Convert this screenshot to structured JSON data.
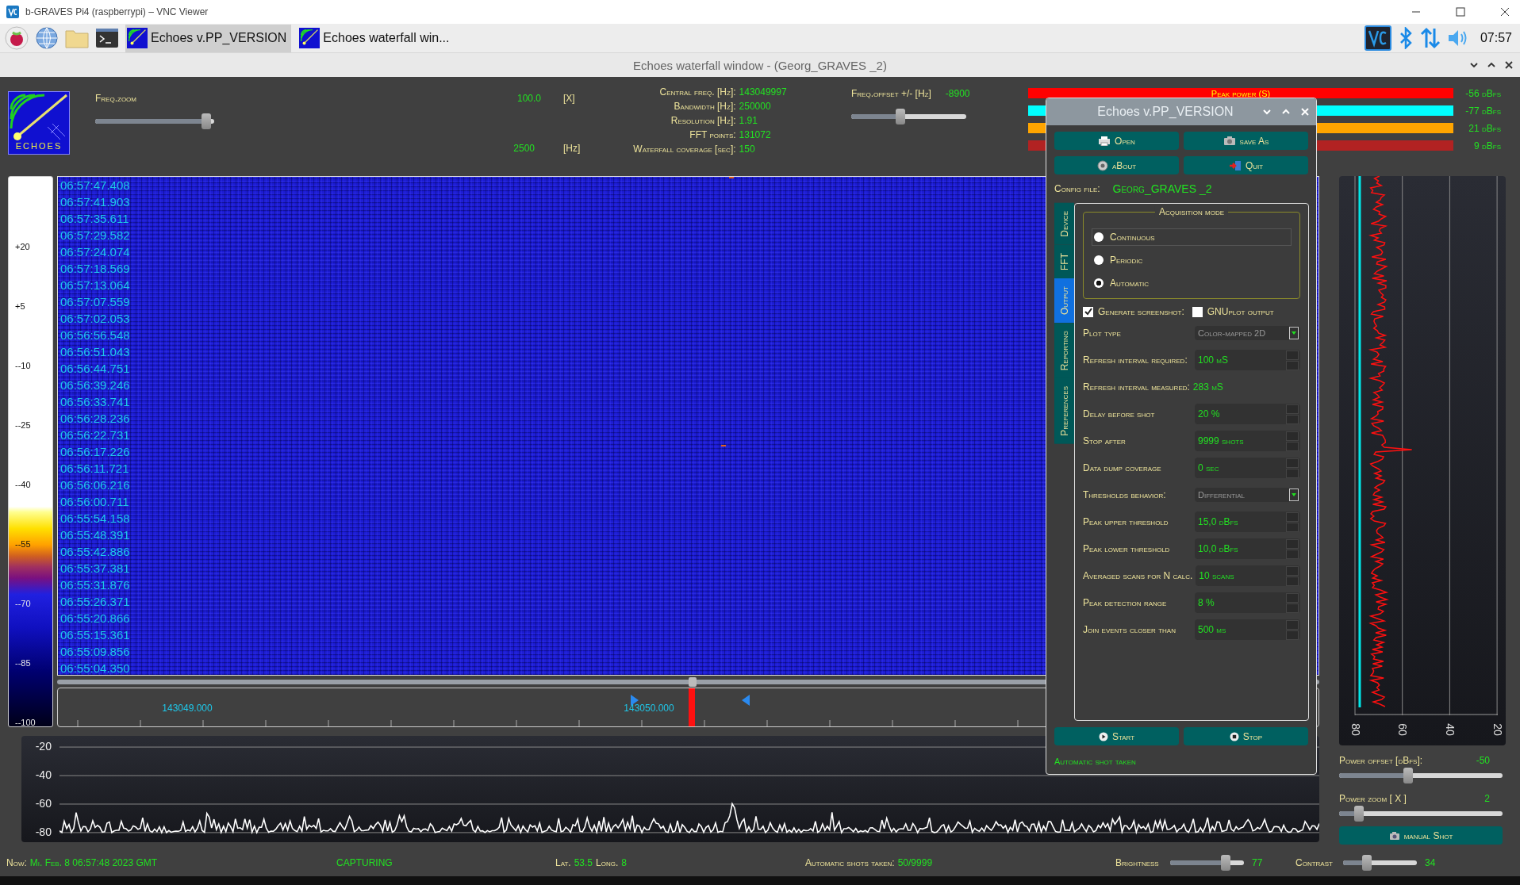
{
  "vnc_window": {
    "title": "b-GRAVES Pi4 (raspberrypi) – VNC Viewer"
  },
  "taskbar": {
    "tasks": [
      {
        "label": "Echoes v.PP_VERSION",
        "selected": true
      },
      {
        "label": "Echoes waterfall win...",
        "selected": false
      }
    ],
    "clock": "07:57"
  },
  "window": {
    "title": "Echoes waterfall window - (Georg_GRAVES _2)"
  },
  "header": {
    "logo_text": "ECHOES",
    "freq_zoom": {
      "label": "Freq.zoom",
      "level": 0.93,
      "value": "100.0",
      "unit": "[X]"
    },
    "span": {
      "value": "2500",
      "unit": "[Hz]"
    }
  },
  "info": [
    {
      "label": "Central freq. [Hz]:",
      "value": "143049997"
    },
    {
      "label": "Bandwidth  [Hz]:",
      "value": "250000"
    },
    {
      "label": "Resolution [Hz]:",
      "value": "1.91"
    },
    {
      "label": "FFT points:",
      "value": "131072"
    },
    {
      "label": "Waterfall coverage [sec]:",
      "value": "150"
    }
  ],
  "freq_offset": {
    "label": "Freq.offset +/- [Hz]",
    "value": "-8900",
    "level": 0.43
  },
  "power_bars": [
    {
      "label": "Peak power (S)",
      "color": "#ff0000",
      "reading": "-56 dBfs"
    },
    {
      "color": "#00ffff",
      "reading": "-77 dBfs"
    },
    {
      "color": "#ffa500",
      "reading": "21 dBfs"
    },
    {
      "color": "#b22222",
      "reading": "9 dBfs"
    }
  ],
  "color_scale": {
    "labels": [
      "+20",
      "+5",
      "--10",
      "--25",
      "--40",
      "--55",
      "--70",
      "--85",
      "--100"
    ]
  },
  "waterfall": {
    "timestamps": [
      "06:57:47.408",
      "06:57:41.903",
      "06:57:35.611",
      "06:57:29.582",
      "06:57:24.074",
      "06:57:18.569",
      "06:57:13.064",
      "06:57:07.559",
      "06:57:02.053",
      "06:56:56.548",
      "06:56:51.043",
      "06:56:44.751",
      "06:56:39.246",
      "06:56:33.741",
      "06:56:28.236",
      "06:56:22.731",
      "06:56:17.226",
      "06:56:11.721",
      "06:56:06.216",
      "06:56:00.711",
      "06:55:54.158",
      "06:55:48.391",
      "06:55:42.886",
      "06:55:37.381",
      "06:55:31.876",
      "06:55:26.371",
      "06:55:20.866",
      "06:55:15.361",
      "06:55:09.856",
      "06:55:04.350"
    ]
  },
  "freq_axis": {
    "labels": [
      "143049.000",
      "143050.000"
    ]
  },
  "spectrum": {
    "y_labels": [
      "-20",
      "-40",
      "-60",
      "-80"
    ]
  },
  "power_plot": {
    "x_labels": [
      "80",
      "60",
      "40",
      "20"
    ]
  },
  "power_offset": {
    "label": "Power offset [dBfs]:",
    "value": "-50",
    "level": 0.42
  },
  "power_zoom": {
    "label": "Power zoom  [ X ]",
    "value": "2",
    "level": 0.12
  },
  "manual_shot_button": "manual Shot",
  "status_bar": {
    "now_label": "Now:",
    "now_value": "Mi. Feb. 8 06:57:48 2023 GMT",
    "state": "CAPTURING",
    "lat_label": "Lat.",
    "lat": "53.5",
    "long_label": "Long.",
    "long": "8",
    "shots_label": "Automatic shots taken:",
    "shots": "50/9999",
    "brightness": {
      "label": "Brightness",
      "value": "77",
      "level": 0.75
    },
    "contrast": {
      "label": "Contrast",
      "value": "34",
      "level": 0.32
    }
  },
  "dialog": {
    "title": "Echoes v.PP_VERSION",
    "buttons": [
      "Open",
      "save As",
      "aBout",
      "Quit"
    ],
    "config_label": "Config file:",
    "config_value": "Georg_GRAVES _2",
    "tabs": [
      {
        "label": "Device",
        "selected": false
      },
      {
        "label": "FFT",
        "selected": false
      },
      {
        "label": "Output",
        "selected": true
      },
      {
        "label": "Reporting",
        "selected": false
      },
      {
        "label": "Preferences",
        "selected": false
      }
    ],
    "acquisition": {
      "title": "Acquisition mode",
      "options": [
        {
          "label": "Continuous",
          "selected": false,
          "focused": true
        },
        {
          "label": "Periodic",
          "selected": false,
          "focused": false
        },
        {
          "label": "Automatic",
          "selected": true,
          "focused": false
        }
      ]
    },
    "checks": [
      {
        "label": "Generate screenshot:",
        "checked": true
      },
      {
        "label": "GNUplot output",
        "checked": false
      }
    ],
    "rows": [
      {
        "kind": "dropdown",
        "label": "Plot type",
        "value": "Color-mapped 2D",
        "disabled": true
      },
      {
        "kind": "spin",
        "label": "Refresh interval  required:",
        "value": "100 mS"
      },
      {
        "kind": "readout",
        "label": "Refresh interval measured:",
        "value": "283 mS"
      },
      {
        "kind": "spin",
        "label": "Delay before shot",
        "value": "20 %"
      },
      {
        "kind": "spin",
        "label": "Stop after",
        "value": "9999 shots"
      },
      {
        "kind": "spin",
        "label": "Data dump coverage",
        "value": "0 sec"
      },
      {
        "kind": "dropdown",
        "label": "Thresholds behavior:",
        "value": "Differential",
        "disabled": true
      },
      {
        "kind": "spin",
        "label": "Peak upper threshold",
        "value": "15,0 dBfs"
      },
      {
        "kind": "spin",
        "label": "Peak lower threshold",
        "value": "10,0 dBfs"
      },
      {
        "kind": "spin",
        "label": "Averaged scans for N calc.",
        "value": "10 scans"
      },
      {
        "kind": "spin",
        "label": "Peak detection range",
        "value": "8 %"
      },
      {
        "kind": "spin",
        "label": "Join events closer than",
        "value": "500 ms"
      }
    ],
    "action_buttons": [
      "Start",
      "Stop"
    ],
    "status": "Automatic shot taken"
  }
}
